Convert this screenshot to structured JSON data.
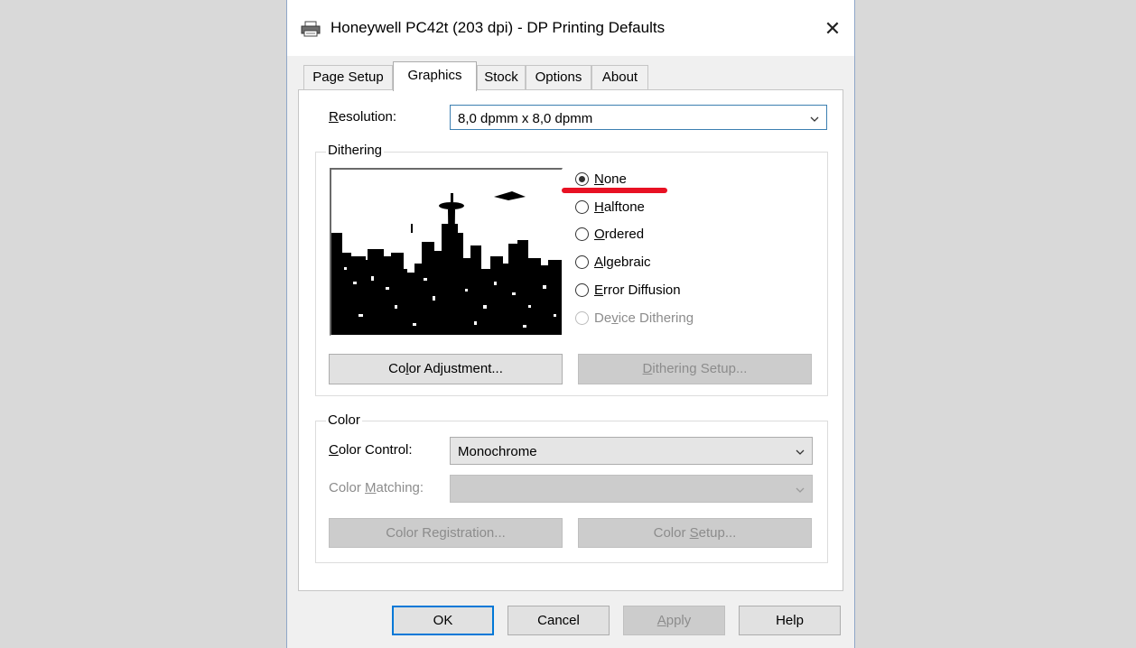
{
  "window": {
    "title": "Honeywell PC42t (203 dpi) - DP Printing Defaults",
    "close_label": "✕"
  },
  "tabs": [
    {
      "label": "Page Setup"
    },
    {
      "label": "Graphics",
      "active": true
    },
    {
      "label": "Stock"
    },
    {
      "label": "Options"
    },
    {
      "label": "About"
    }
  ],
  "resolution": {
    "label": "Resolution:",
    "value": "8,0 dpmm x 8,0 dpmm"
  },
  "dithering": {
    "group_title": "Dithering",
    "options": [
      {
        "label": "None",
        "checked": true,
        "enabled": true
      },
      {
        "label": "Halftone",
        "checked": false,
        "enabled": true
      },
      {
        "label": "Ordered",
        "checked": false,
        "enabled": true
      },
      {
        "label": "Algebraic",
        "checked": false,
        "enabled": true
      },
      {
        "label": "Error Diffusion",
        "checked": false,
        "enabled": true
      },
      {
        "label": "Device Dithering",
        "checked": false,
        "enabled": false
      }
    ],
    "color_adjustment_label": "Color Adjustment...",
    "dithering_setup_label": "Dithering Setup..."
  },
  "color": {
    "group_title": "Color",
    "control_label": "Color Control:",
    "control_value": "Monochrome",
    "matching_label": "Color Matching:",
    "matching_value": "",
    "registration_label": "Color Registration...",
    "setup_label": "Color Setup..."
  },
  "footer": {
    "ok": "OK",
    "cancel": "Cancel",
    "apply": "Apply",
    "help": "Help"
  },
  "colors": {
    "annotation": "#e81123",
    "focus": "#0078d7"
  },
  "icons": [
    "printer-icon",
    "close-icon",
    "chevron-down-icon"
  ]
}
